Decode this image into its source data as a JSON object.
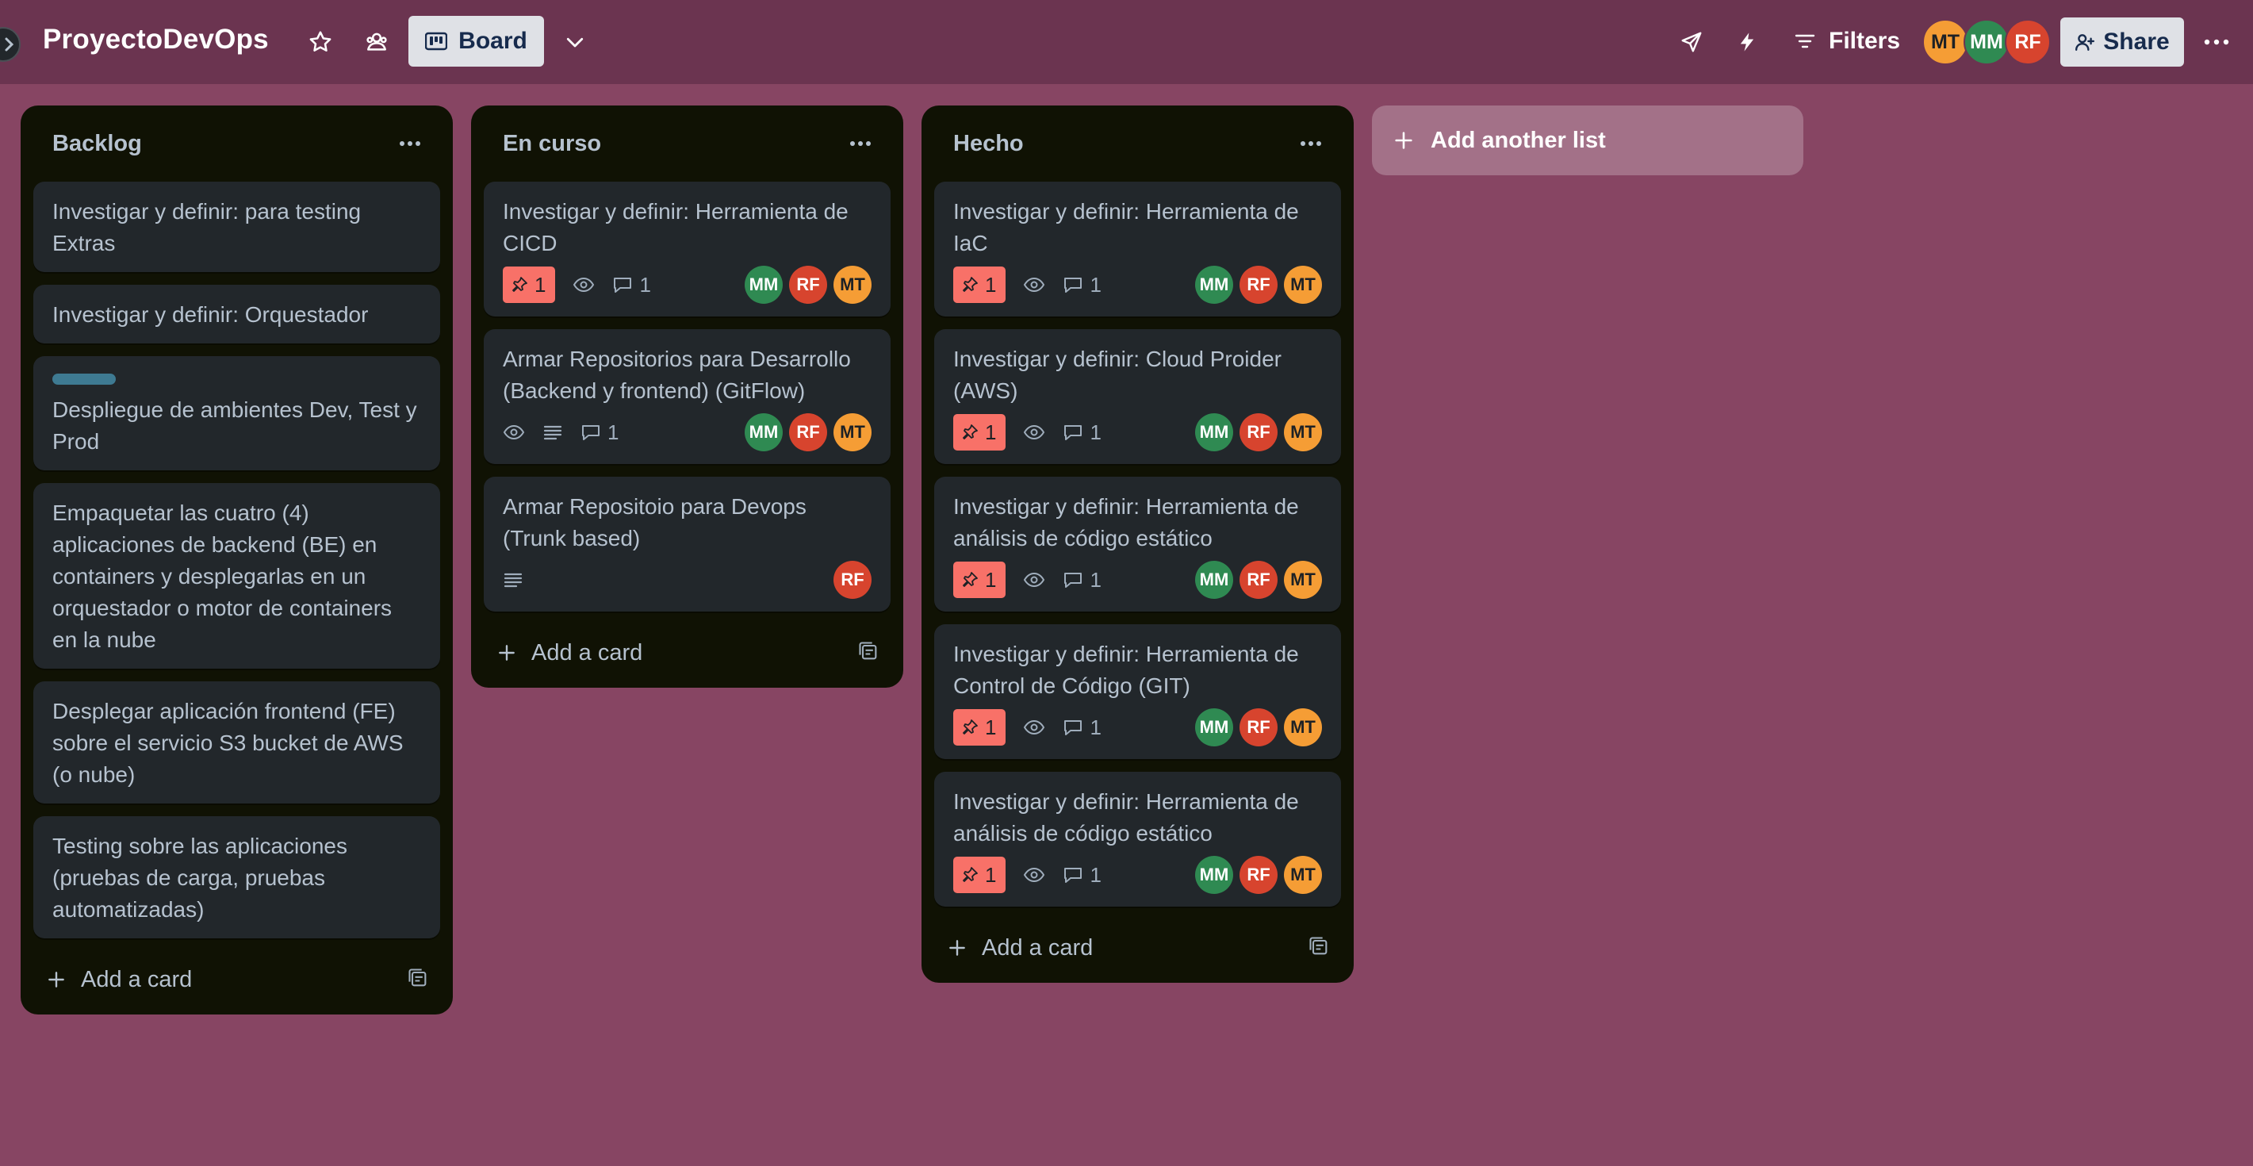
{
  "header": {
    "board_title": "ProyectoDevOps",
    "view_label": "Board",
    "filters_label": "Filters",
    "share_label": "Share",
    "members": [
      {
        "initials": "MT",
        "color": "#f59d35"
      },
      {
        "initials": "MM",
        "color": "#2f8a52"
      },
      {
        "initials": "RF",
        "color": "#d7442e"
      }
    ]
  },
  "lists": [
    {
      "title": "Backlog",
      "add_card_label": "Add a card",
      "cards": [
        {
          "title": "Investigar y definir: para testing Extras"
        },
        {
          "title": "Investigar y definir: Orquestador"
        },
        {
          "title": "Despliegue de ambientes Dev, Test y Prod",
          "label_color": "#3e7a92"
        },
        {
          "title": "Empaquetar las cuatro (4) aplicaciones de backend (BE) en containers y desplegarlas en un orquestador o motor de containers en la nube"
        },
        {
          "title": "Desplegar aplicación frontend (FE) sobre el servicio S3 bucket de AWS (o nube)"
        },
        {
          "title": "Testing sobre las aplicaciones (pruebas de carga, pruebas automatizadas)"
        }
      ]
    },
    {
      "title": "En curso",
      "add_card_label": "Add a card",
      "cards": [
        {
          "title": "Investigar y definir: Herramienta de CICD",
          "due": "1",
          "comments": "1",
          "members": [
            "MM",
            "RF",
            "MT"
          ]
        },
        {
          "title": "Armar Repositorios para Desarrollo (Backend y frontend) (GitFlow)",
          "comments": "1",
          "members": [
            "MM",
            "RF",
            "MT"
          ]
        },
        {
          "title": "Armar Repositoio para Devops (Trunk based)",
          "members": [
            "RF"
          ]
        }
      ]
    },
    {
      "title": "Hecho",
      "add_card_label": "Add a card",
      "cards": [
        {
          "title": "Investigar y definir: Herramienta de IaC",
          "due": "1",
          "comments": "1",
          "members": [
            "MM",
            "RF",
            "MT"
          ]
        },
        {
          "title": "Investigar y definir: Cloud Proider (AWS)",
          "due": "1",
          "comments": "1",
          "members": [
            "MM",
            "RF",
            "MT"
          ]
        },
        {
          "title": "Investigar y definir: Herramienta de análisis de código estático",
          "due": "1",
          "comments": "1",
          "members": [
            "MM",
            "RF",
            "MT"
          ]
        },
        {
          "title": "Investigar y definir: Herramienta de Control de Código (GIT)",
          "due": "1",
          "comments": "1",
          "members": [
            "MM",
            "RF",
            "MT"
          ]
        },
        {
          "title": "Investigar y definir: Herramienta de análisis de código estático",
          "due": "1",
          "comments": "1",
          "members": [
            "MM",
            "RF",
            "MT"
          ]
        }
      ]
    }
  ],
  "add_list_label": "Add another list",
  "colors": {
    "background": "#874563",
    "header": "#6b3450",
    "list": "#101204",
    "card": "#22272b",
    "due_badge": "#f87168"
  },
  "icons": [
    "star-icon",
    "workspace-visibility-icon",
    "board-icon",
    "chevron-down-icon",
    "send-icon",
    "lightning-icon",
    "filter-icon",
    "add-member-icon",
    "more-icon",
    "pin-icon",
    "eye-icon",
    "comment-icon",
    "description-icon",
    "plus-icon",
    "template-icon"
  ]
}
